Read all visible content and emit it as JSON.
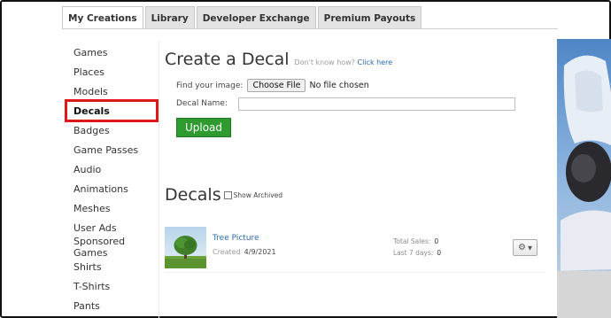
{
  "tabs": [
    {
      "label": "My Creations",
      "active": true
    },
    {
      "label": "Library",
      "active": false
    },
    {
      "label": "Developer Exchange",
      "active": false
    },
    {
      "label": "Premium Payouts",
      "active": false
    }
  ],
  "sidebar": {
    "items": [
      {
        "label": "Games"
      },
      {
        "label": "Places"
      },
      {
        "label": "Models"
      },
      {
        "label": "Decals",
        "active": true
      },
      {
        "label": "Badges"
      },
      {
        "label": "Game Passes"
      },
      {
        "label": "Audio"
      },
      {
        "label": "Animations"
      },
      {
        "label": "Meshes"
      },
      {
        "label": "User Ads"
      },
      {
        "label": "Sponsored Games"
      },
      {
        "label": "Shirts"
      },
      {
        "label": "T-Shirts"
      },
      {
        "label": "Pants"
      }
    ],
    "highlight_color": "#e0161b"
  },
  "create": {
    "title": "Create a Decal",
    "hint_prefix": "Don't know how?",
    "hint_link": "Click here",
    "find_label": "Find your image:",
    "choose_button": "Choose File",
    "file_status": "No file chosen",
    "name_label": "Decal Name:",
    "name_value": "",
    "upload_button": "Upload",
    "upload_color": "#2f9a2f"
  },
  "decals": {
    "title": "Decals",
    "show_archived_label": "Show Archived",
    "show_archived_checked": false,
    "items": [
      {
        "name": "Tree Picture",
        "created_label": "Created",
        "created_date": "4/9/2021",
        "total_sales_label": "Total Sales:",
        "total_sales": "0",
        "last7_label": "Last 7 days:",
        "last7": "0"
      }
    ]
  },
  "icons": {
    "gear": "gear-icon",
    "caret": "caret-down-icon"
  },
  "link_color": "#2b6aa9"
}
